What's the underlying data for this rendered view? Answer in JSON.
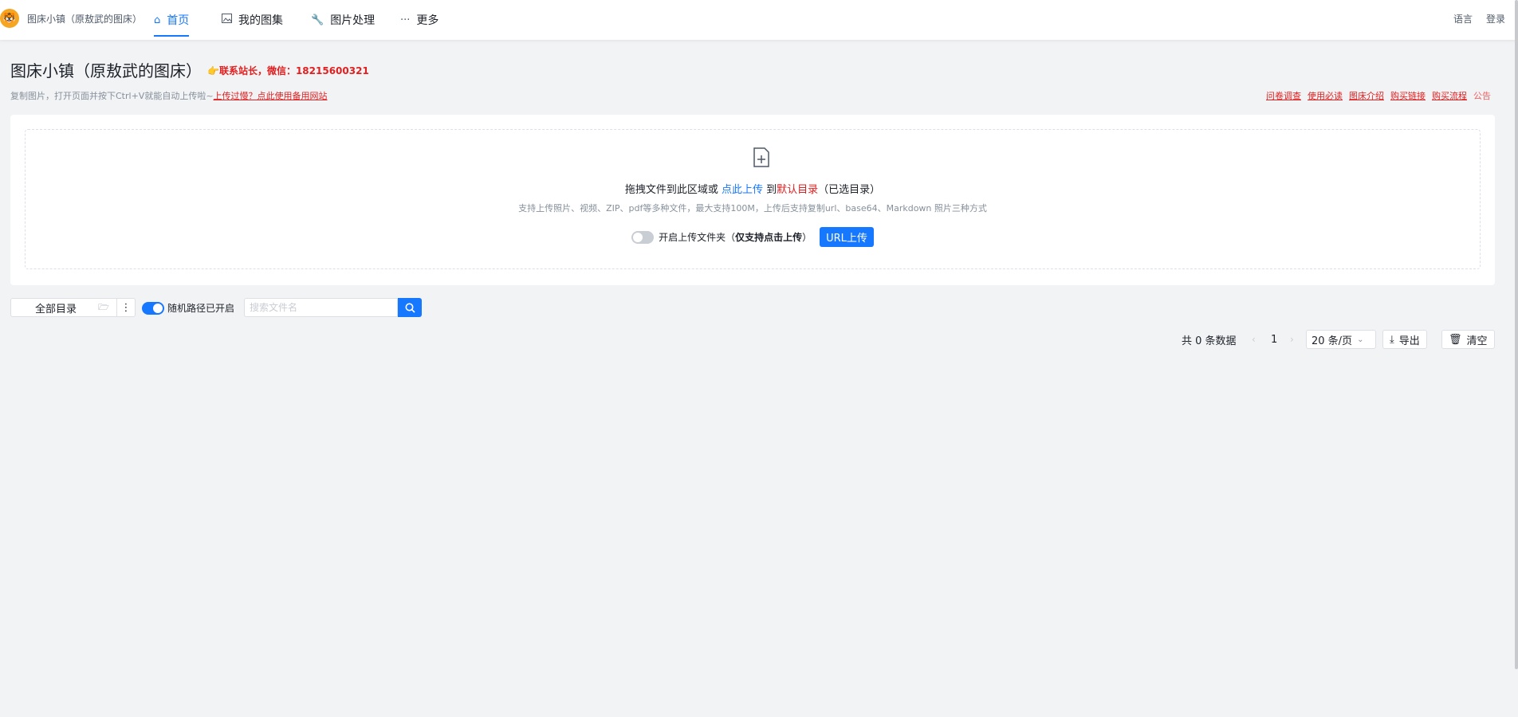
{
  "nav": {
    "site_name": "图床小镇（原敖武的图床）",
    "items": [
      {
        "label": "首页",
        "icon": "home-icon",
        "active": true
      },
      {
        "label": "我的图集",
        "icon": "image-icon",
        "active": false
      },
      {
        "label": "图片处理",
        "icon": "wrench-icon",
        "active": false
      },
      {
        "label": "更多",
        "icon": "ellipsis-icon",
        "active": false
      }
    ],
    "language": "语言",
    "login": "登录"
  },
  "header": {
    "title": "图床小镇（原敖武的图床）",
    "contact": "👉联系站长，微信：18215600321",
    "desc": "复制图片，打开页面并按下Ctrl+V就能自动上传啦~",
    "desc_link": "上传过慢？点此使用备用网站",
    "links": [
      "问卷调查",
      "使用必读",
      "图床介绍",
      "购买链接",
      "购买流程",
      "公告"
    ]
  },
  "upload": {
    "main_prefix": "拖拽文件到此区域或",
    "click_upload": "点此上传",
    "to": "到",
    "default_dir": "默认目录",
    "selected_dir": "（已选目录）",
    "sub": "支持上传照片、视频、ZIP、pdf等多种文件，最大支持100M，上传后支持复制url、base64、Markdown 照片三种方式",
    "folder_label": "开启上传文件夹（",
    "folder_bold": "仅支持点击上传",
    "folder_close": "）",
    "url_button": "URL上传"
  },
  "toolbar": {
    "dir_label": "全部目录",
    "random_path": "随机路径已开启",
    "search_placeholder": "搜索文件名"
  },
  "pager": {
    "total": "共 0 条数据",
    "current": "1",
    "page_size": "20 条/页",
    "export": "导出",
    "clear": "清空"
  },
  "colors": {
    "accent": "#1677ff",
    "danger": "#e02020"
  }
}
